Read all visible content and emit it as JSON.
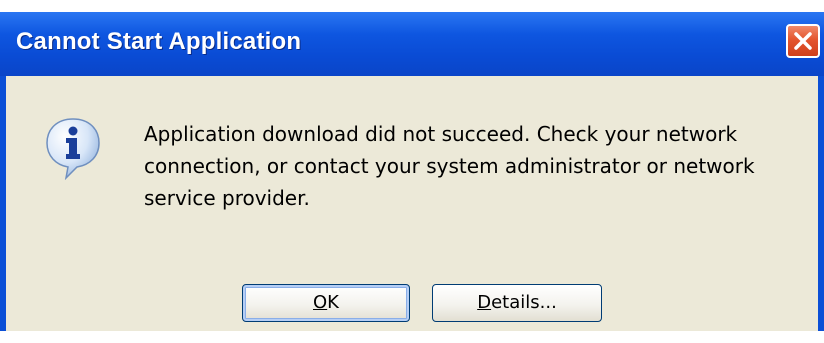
{
  "window": {
    "title": "Cannot Start Application"
  },
  "message": {
    "text": "Application download did not succeed. Check your network connection, or contact your system administrator or network service provider."
  },
  "buttons": {
    "ok": {
      "mnemonic": "O",
      "rest": "K"
    },
    "details": {
      "mnemonic": "D",
      "rest": "etails..."
    }
  },
  "icons": {
    "message_icon": "information-icon",
    "close_icon": "close-icon"
  },
  "colors": {
    "titlebar": "#0a4bd4",
    "client_background": "#ece9d8",
    "close_button": "#e4552e"
  }
}
